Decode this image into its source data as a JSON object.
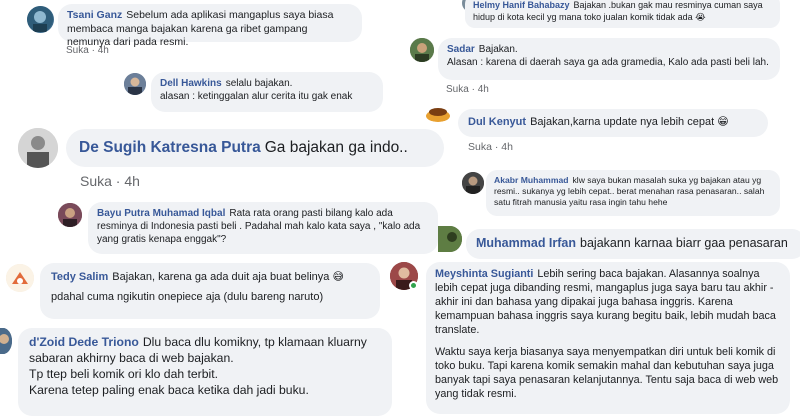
{
  "comments": [
    {
      "id": "tsani",
      "name": "Tsani Ganz",
      "text": "Sebelum ada aplikasi mangaplus saya biasa membaca manga bajakan karena ga ribet gampang nemunya dari pada resmi.",
      "like": "Suka",
      "time": "4h"
    },
    {
      "id": "helmy",
      "name": "Helmy Hanif Bahabazy",
      "text": "Bajakan .bukan gak mau resminya cuman saya hidup di kota kecil yg mana toko jualan komik tidak ada",
      "emoji": "😭"
    },
    {
      "id": "sadar",
      "name": "Sadar",
      "text": "Bajakan.",
      "text2": "Alasan : karena di daerah saya ga ada gramedia, Kalo ada pasti beli lah.",
      "like": "Suka",
      "time": "4h"
    },
    {
      "id": "dell",
      "name": "Dell Hawkins",
      "text": "selalu bajakan.",
      "text2": "alasan : ketinggalan alur cerita itu gak enak"
    },
    {
      "id": "dul",
      "name": "Dul Kenyut",
      "text": "Bajakan,karna update nya lebih cepat",
      "emoji": "😁",
      "like": "Suka",
      "time": "4h"
    },
    {
      "id": "desugih",
      "name": "De Sugih Katresna Putra",
      "text": "Ga bajakan ga indo..",
      "like": "Suka",
      "time": "4h"
    },
    {
      "id": "akabr",
      "name": "Akabr Muhammad",
      "text": "klw saya bukan masalah suka yg bajakan atau yg resmi.. sukanya yg lebih cepat.. berat menahan rasa penasaran.. salah satu fitrah manusia yaitu rasa ingin tahu hehe"
    },
    {
      "id": "bayu",
      "name": "Bayu Putra Muhamad Iqbal",
      "text": "Rata rata orang pasti bilang kalo ada resminya di Indonesia pasti beli . Padahal mah kalo kata saya , \"kalo ada yang gratis kenapa enggak\"?"
    },
    {
      "id": "irfan",
      "name": "Muhammad Irfan",
      "text": "bajakann karnaa biarr gaa penasaran"
    },
    {
      "id": "tedy",
      "name": "Tedy Salim",
      "text": "Bajakan, karena ga ada duit aja buat belinya",
      "emoji": "😅",
      "text2": "pdahal cuma ngikutin onepiece aja (dulu bareng naruto)"
    },
    {
      "id": "meyshinta",
      "name": "Meyshinta Sugianti",
      "text": "Lebih sering baca bajakan. Alasannya soalnya lebih cepat juga dibanding resmi, mangaplus juga saya baru tau akhir - akhir ini dan bahasa yang dipakai juga bahasa inggris. Karena kemampuan bahasa inggris saya kurang begitu baik, lebih mudah baca translate.",
      "text2": "Waktu saya kerja biasanya saya menyempatkan diri untuk beli komik di toko buku. Tapi karena komik semakin mahal dan kebutuhan saya juga banyak tapi saya penasaran kelanjutannya. Tentu saja baca di web web yang tidak resmi."
    },
    {
      "id": "dzoid",
      "name": "d'Zoid Dede Triono",
      "text": "Dlu baca dlu komikny, tp klamaan kluarny sabaran akhirny baca di web bajakan.",
      "text2": "Tp ttep beli komik ori klo dah terbit.",
      "text3": "Karena tetep paling enak baca ketika dah jadi buku."
    }
  ],
  "colors": {
    "bubble": "#f0f2f5",
    "name": "#385898",
    "meta": "#65676b",
    "online": "#31a24c"
  }
}
